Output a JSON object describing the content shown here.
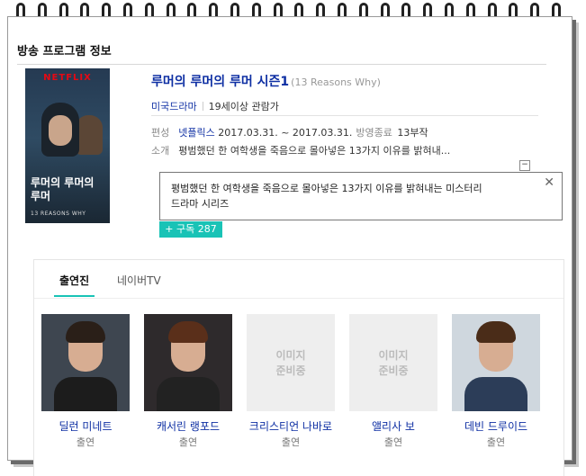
{
  "section_title": "방송 프로그램 정보",
  "poster": {
    "brand": "NETFLIX",
    "title_kr": "루머의 루머의 루머",
    "subtitle": "13 REASONS WHY"
  },
  "show": {
    "title": "루머의 루머의 루머 시즌1",
    "original_title": "(13 Reasons Why)",
    "genre": "미국드라마",
    "rating": "19세이상 관람가"
  },
  "info": {
    "schedule_label": "편성",
    "broadcaster": "넷플릭스",
    "dates": "2017.03.31. ~ 2017.03.31.",
    "status": "방영종료",
    "episodes": "13부작",
    "summary_label": "소개",
    "summary_short": "평범했던 한 여학생을 죽음으로 몰아넣은 13가지 이유를 밝혀내..."
  },
  "tooltip": {
    "text_line1": "평범했던 한 여학생을 죽음으로 몰아넣은 13가지 이유를 밝혀내는 미스터리",
    "text_line2": "드라마 시리즈",
    "close_glyph": "✕"
  },
  "subscribe": {
    "label": "+ 구독 287"
  },
  "collapse_glyph": "−",
  "tabs": [
    {
      "label": "출연진",
      "active": true
    },
    {
      "label": "네이버TV",
      "active": false
    }
  ],
  "cast": [
    {
      "name": "딜런 미네트",
      "role": "출연",
      "has_photo": true,
      "hair": "#2a1f18",
      "bg": "#3e4650",
      "shirt": "#1c1c1c"
    },
    {
      "name": "캐서린 랭포드",
      "role": "출연",
      "has_photo": true,
      "hair": "#5a2f1a",
      "bg": "#2e2a2c",
      "shirt": "#222"
    },
    {
      "name": "크리스티언 나바로",
      "role": "출연",
      "has_photo": false,
      "placeholder": "이미지\n준비중"
    },
    {
      "name": "앨리사 보",
      "role": "출연",
      "has_photo": false,
      "placeholder": "이미지\n준비중"
    },
    {
      "name": "데빈 드루이드",
      "role": "출연",
      "has_photo": true,
      "hair": "#4a2c18",
      "bg": "#cfd7de",
      "shirt": "#2c3d58"
    }
  ]
}
